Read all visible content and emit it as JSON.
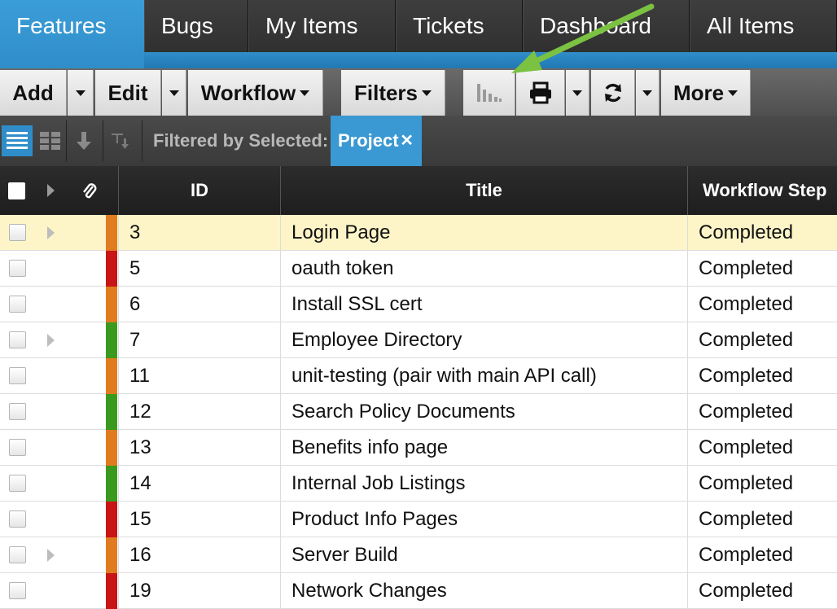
{
  "tabs": [
    {
      "label": "Features",
      "active": true
    },
    {
      "label": "Bugs"
    },
    {
      "label": "My Items"
    },
    {
      "label": "Tickets"
    },
    {
      "label": "Dashboard"
    },
    {
      "label": "All Items"
    }
  ],
  "toolbar": {
    "add_label": "Add",
    "edit_label": "Edit",
    "workflow_label": "Workflow",
    "filters_label": "Filters",
    "more_label": "More"
  },
  "icons": {
    "list_view": "list-view-icon",
    "grid_view": "grid-view-icon",
    "sort": "sort-down-icon",
    "filter_sort": "filter-sort-icon",
    "chart": "bar-chart-icon",
    "print": "printer-icon",
    "refresh": "refresh-icon",
    "remove": "close-icon",
    "attachment": "paperclip-icon"
  },
  "filter": {
    "label": "Filtered by Selected:",
    "chip": "Project",
    "chip_remove": "✕"
  },
  "grid": {
    "columns": {
      "id": "ID",
      "title": "Title",
      "workflow": "Workflow Step"
    },
    "rows": [
      {
        "id": "3",
        "title": "Login Page",
        "workflow": "Completed",
        "priority": "orange",
        "expandable": true,
        "highlighted": true
      },
      {
        "id": "5",
        "title": "oauth token",
        "workflow": "Completed",
        "priority": "red",
        "expandable": false
      },
      {
        "id": "6",
        "title": "Install SSL cert",
        "workflow": "Completed",
        "priority": "orange",
        "expandable": false
      },
      {
        "id": "7",
        "title": "Employee Directory",
        "workflow": "Completed",
        "priority": "green",
        "expandable": true
      },
      {
        "id": "11",
        "title": "unit-testing (pair with main API call)",
        "workflow": "Completed",
        "priority": "orange",
        "expandable": false
      },
      {
        "id": "12",
        "title": "Search Policy Documents",
        "workflow": "Completed",
        "priority": "green",
        "expandable": false
      },
      {
        "id": "13",
        "title": "Benefits info page",
        "workflow": "Completed",
        "priority": "orange",
        "expandable": false
      },
      {
        "id": "14",
        "title": "Internal Job Listings",
        "workflow": "Completed",
        "priority": "green",
        "expandable": false
      },
      {
        "id": "15",
        "title": "Product Info Pages",
        "workflow": "Completed",
        "priority": "red",
        "expandable": false
      },
      {
        "id": "16",
        "title": "Server Build",
        "workflow": "Completed",
        "priority": "orange",
        "expandable": true
      },
      {
        "id": "19",
        "title": "Network Changes",
        "workflow": "Completed",
        "priority": "red",
        "expandable": false
      }
    ]
  },
  "colors": {
    "accent": "#2f8ec9",
    "priority_red": "#c81515",
    "priority_orange": "#e07b20",
    "priority_green": "#3a9a1e",
    "highlight_row": "#fdf5c7",
    "annotation_arrow": "#7bc142"
  }
}
